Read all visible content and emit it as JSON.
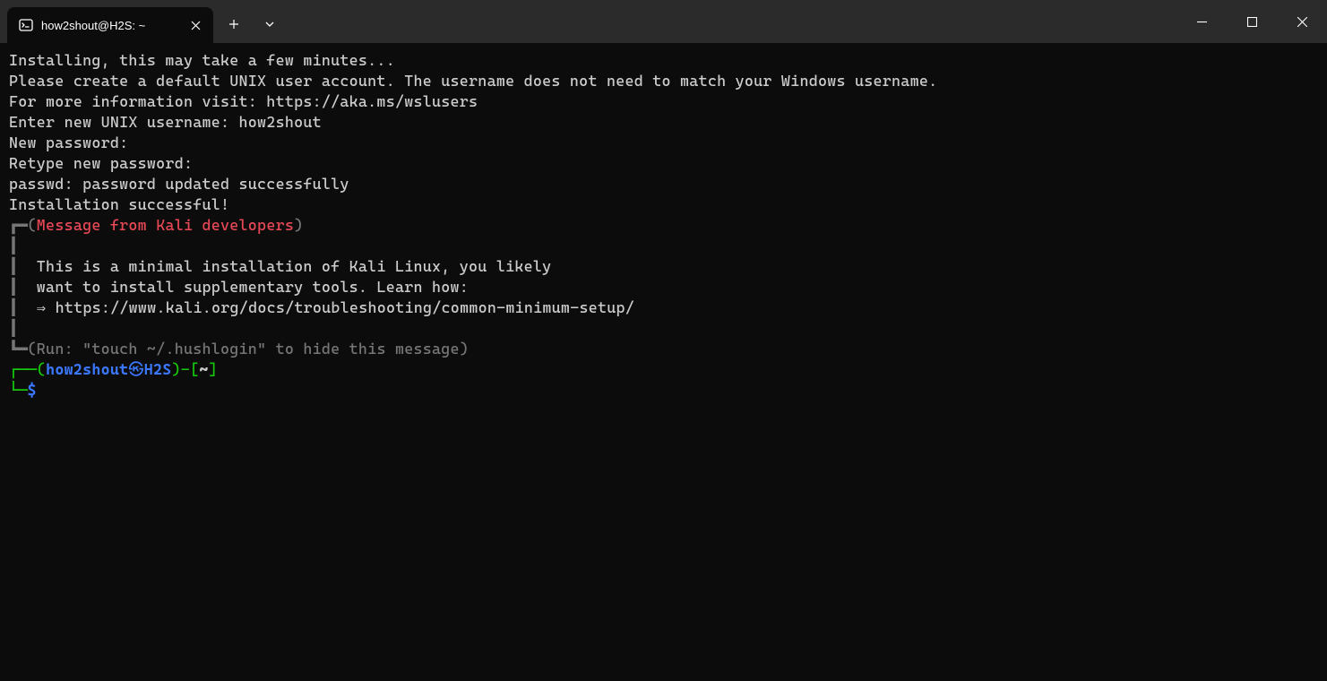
{
  "window": {
    "tab_title": "how2shout@H2S: ~"
  },
  "terminal": {
    "lines": {
      "l1": "Installing, this may take a few minutes...",
      "l2": "Please create a default UNIX user account. The username does not need to match your Windows username.",
      "l3": "For more information visit: https://aka.ms/wslusers",
      "l4_prefix": "Enter new UNIX username: ",
      "l4_username": "how2shout",
      "l5": "New password:",
      "l6": "Retype new password:",
      "l7": "passwd: password updated successfully",
      "l8": "Installation successful!",
      "box_top_corner": "┏━",
      "box_open_paren": "(",
      "box_header": "Message from Kali developers",
      "box_close_paren": ")",
      "box_pipe": "┃",
      "box_msg1": "  This is a minimal installation of Kali Linux, you likely",
      "box_msg2": "  want to install supplementary tools. Learn how:",
      "box_msg3": "  ⇒ https://www.kali.org/docs/troubleshooting/common-minimum-setup/",
      "box_bot_corner": "┗━",
      "box_footer": "Run: \"touch ~/.hushlogin\" to hide this message",
      "prompt_corner_top": "┌──",
      "prompt_open": "(",
      "prompt_user": "how2shout",
      "prompt_sep": "㉿",
      "prompt_host": "H2S",
      "prompt_close": ")",
      "prompt_dash": "-",
      "prompt_bracket_open": "[",
      "prompt_path": "~",
      "prompt_bracket_close": "]",
      "prompt_corner_bot": "└─",
      "prompt_symbol": "$"
    }
  }
}
